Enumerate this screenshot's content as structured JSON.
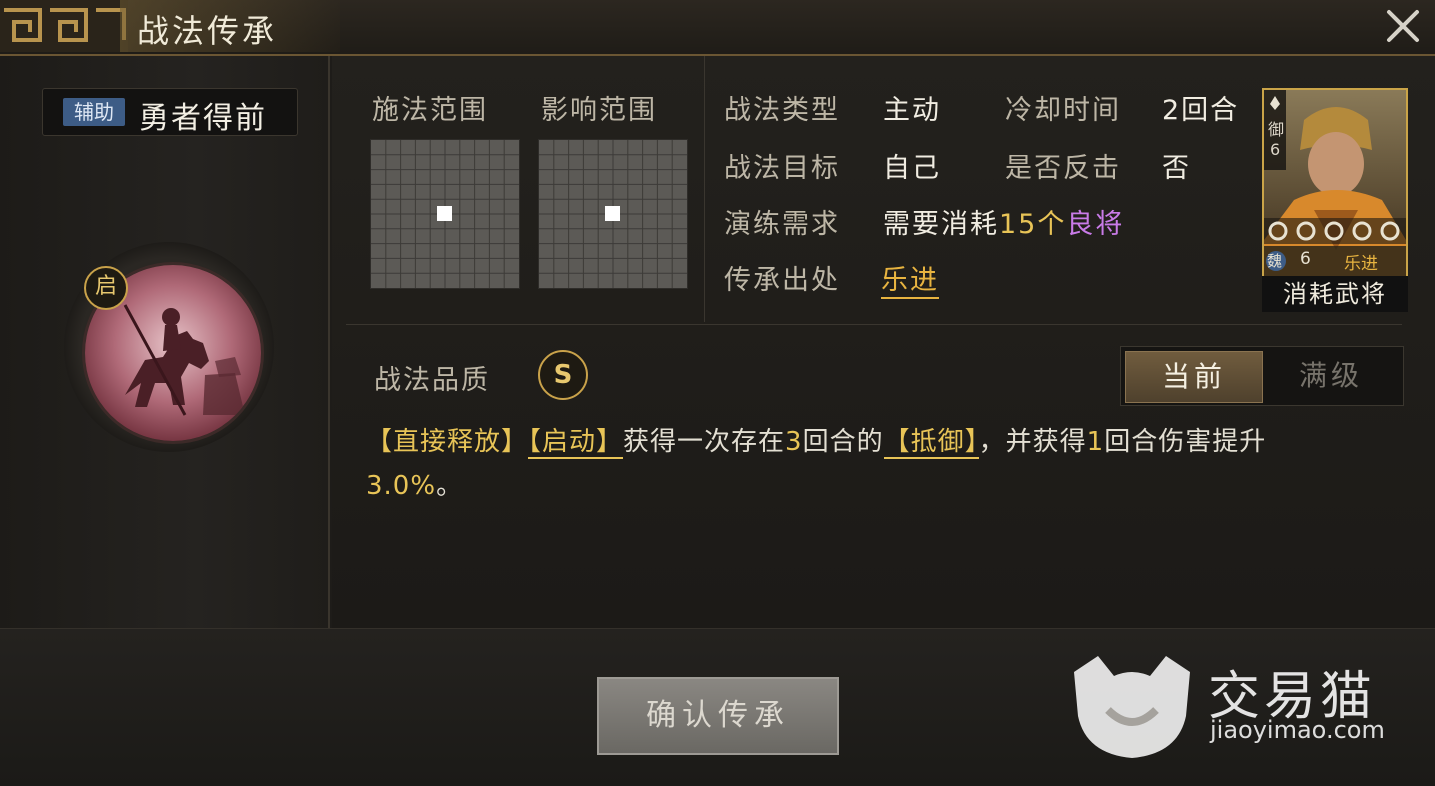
{
  "title": "战法传承",
  "skill": {
    "type_tag": "辅助",
    "name": "勇者得前",
    "badge": "启"
  },
  "range": {
    "cast_label": "施法范围",
    "effect_label": "影响范围"
  },
  "info": {
    "type_label": "战法类型",
    "type_value": "主动",
    "cooldown_label": "冷却时间",
    "cooldown_value": "2回合",
    "target_label": "战法目标",
    "target_value": "自己",
    "counter_label": "是否反击",
    "counter_value": "否",
    "train_label": "演练需求",
    "train_prefix": "需要消耗",
    "train_count": "15个",
    "train_item": "良将",
    "source_label": "传承出处",
    "source_value": "乐进"
  },
  "card": {
    "corner_label": "御",
    "corner_num": "6",
    "faction": "魏",
    "cost": "6",
    "name": "乐进",
    "stars": "ccccc",
    "caption": "消耗武将"
  },
  "quality": {
    "label": "战法品质",
    "grade": "S"
  },
  "toggle": {
    "current": "当前",
    "max": "满级"
  },
  "description": {
    "tag1": "【直接释放】",
    "tag2": "【启动】",
    "part1": "获得一次存在",
    "num1": "3",
    "part2": "回合的",
    "tag3": "【抵御】",
    "part3": "，并获得",
    "num2": "1",
    "part4": "回合伤害提升",
    "num3": "3.0%",
    "part5": "。"
  },
  "confirm_label": "确认传承",
  "watermark": {
    "cn": "交易猫",
    "en": "jiaoyimao.com"
  },
  "colors": {
    "accent_gold": "#e8c457",
    "accent_purple": "#c97be8",
    "link_orange": "#e8b440",
    "aux_tag_blue": "#3d5c86"
  }
}
